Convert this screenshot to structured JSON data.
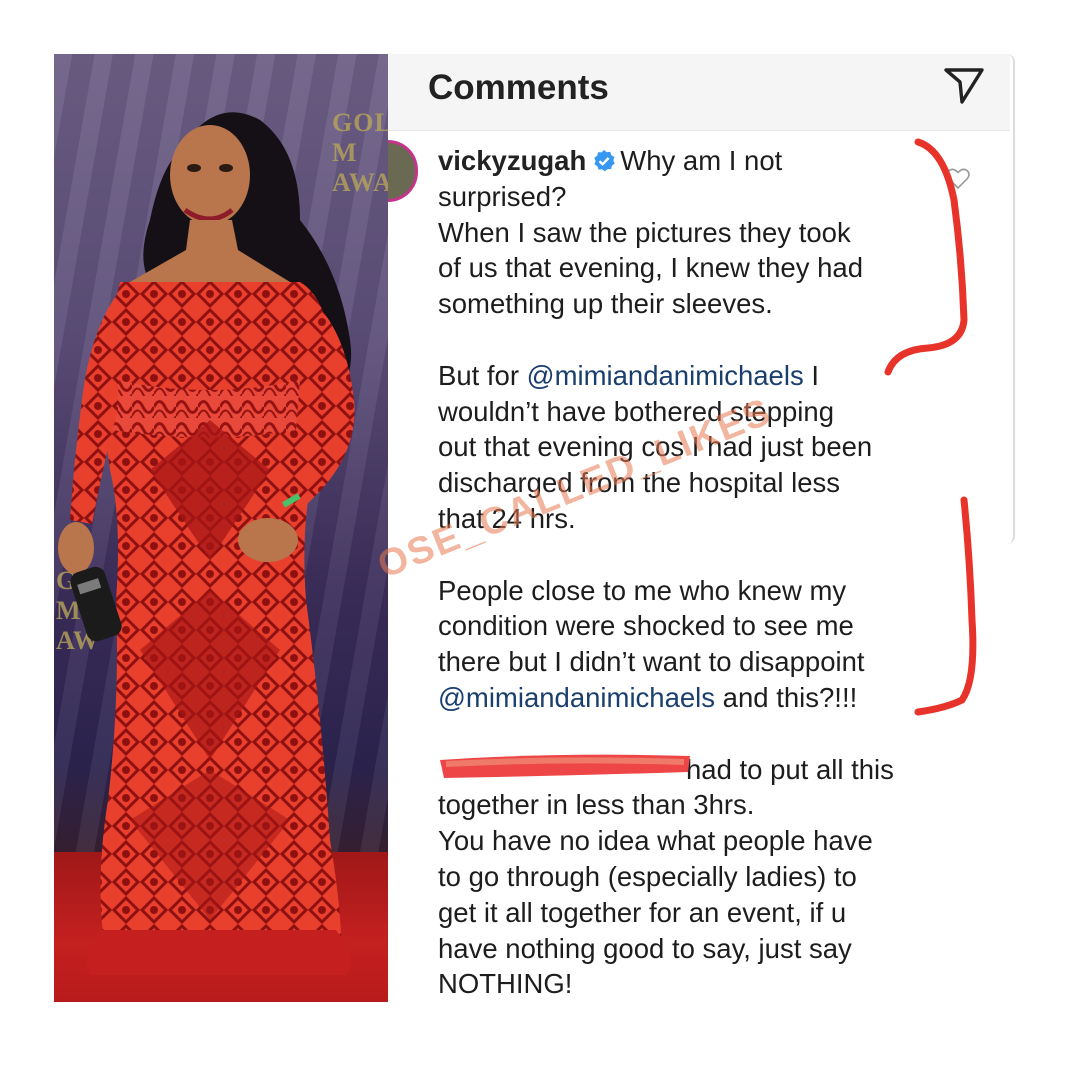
{
  "photo": {
    "backdrop_texts": [
      "GOL",
      "M",
      "AWA",
      "G",
      "M",
      "AW"
    ]
  },
  "header": {
    "title": "Comments",
    "share_icon": "send-icon"
  },
  "comment": {
    "username": "vickyzugah",
    "verified_icon": "verified-badge-icon",
    "like_icon": "heart-outline-icon",
    "lines": {
      "l1": "Why am I not",
      "l2": "surprised?",
      "l3": "When I saw the pictures they took",
      "l4": "of us that evening, I knew they had",
      "l5": "something up their sleeves.",
      "l6_pre": "But for ",
      "l6_mention": "@mimiandanimichaels",
      "l6_post": " I",
      "l7": "wouldn’t have bothered stepping",
      "l8": "out that evening cos I had just been",
      "l9": "discharged from the hospital less",
      "l10": "that 24 hrs.",
      "l11": "People close to me who knew my",
      "l12": "condition were shocked to see me",
      "l13": "there but I didn’t want to disappoint",
      "l14_mention": "@mimiandanimichaels",
      "l14_post": " and this?!!!",
      "l15_post": "had to put all this",
      "l16": "together in less than 3hrs.",
      "l17": "You have no idea what people have",
      "l18": "to go through (especially ladies) to",
      "l19": "get it all together for an event, if u",
      "l20": "have nothing good to say, just say",
      "l21": "NOTHING!"
    }
  },
  "watermark": "OSE_CALLED_LIKES",
  "colors": {
    "mention": "#1a3f6e",
    "annotation_red": "#e8332a",
    "dress_red": "#d4211f"
  }
}
